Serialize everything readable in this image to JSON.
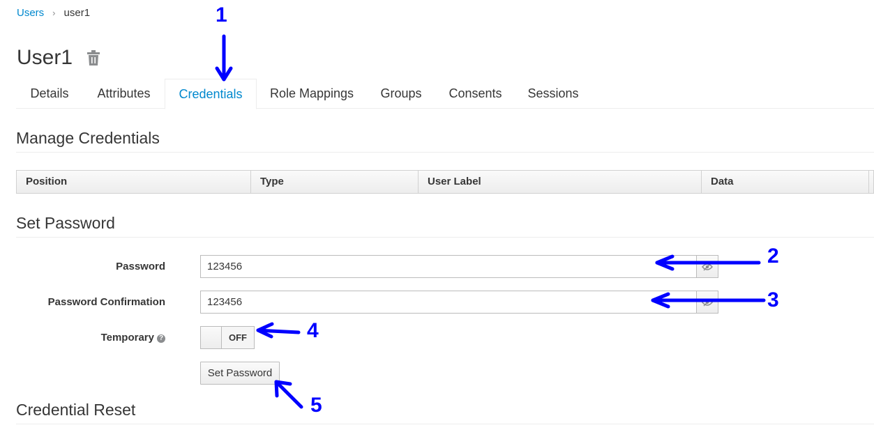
{
  "breadcrumb": {
    "parent": "Users",
    "current": "user1"
  },
  "page": {
    "title": "User1"
  },
  "tabs": [
    {
      "label": "Details"
    },
    {
      "label": "Attributes"
    },
    {
      "label": "Credentials"
    },
    {
      "label": "Role Mappings"
    },
    {
      "label": "Groups"
    },
    {
      "label": "Consents"
    },
    {
      "label": "Sessions"
    }
  ],
  "active_tab": "Credentials",
  "manage_credentials": {
    "title": "Manage Credentials",
    "columns": [
      "Position",
      "Type",
      "User Label",
      "Data"
    ]
  },
  "set_password": {
    "title": "Set Password",
    "password_label": "Password",
    "password_value": "123456",
    "confirmation_label": "Password Confirmation",
    "confirmation_value": "123456",
    "temporary_label": "Temporary",
    "temporary_state": "OFF",
    "button_label": "Set Password"
  },
  "credential_reset": {
    "title": "Credential Reset"
  },
  "annotations": [
    "1",
    "2",
    "3",
    "4",
    "5"
  ],
  "colors": {
    "link": "#0088ce",
    "annotation": "#0000ff",
    "text": "#363636"
  }
}
